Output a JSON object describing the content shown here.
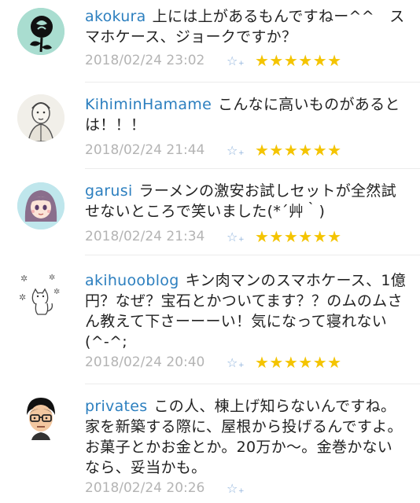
{
  "comments": [
    {
      "user": "akokura",
      "text": "上には上があるもんですねー^^　スマホケース、ジョークですか？",
      "time": "2018/02/24 23:02",
      "add_star": "☆",
      "add_star_plus": "+",
      "stars": "★★★★★★",
      "avatar_icon": "rose-icon"
    },
    {
      "user": "KihiminHamame",
      "text": "こんなに高いものがあるとは！！！",
      "time": "2018/02/24 21:44",
      "add_star": "☆",
      "add_star_plus": "+",
      "stars": "★★★★★★",
      "avatar_icon": "portrait-sketch-icon"
    },
    {
      "user": "garusi",
      "text": "ラーメンの激安お試しセットが全然試せないところで笑いました(*´艸｀)",
      "time": "2018/02/24 21:34",
      "add_star": "☆",
      "add_star_plus": "+",
      "stars": "★★★★★★",
      "avatar_icon": "anime-girl-icon"
    },
    {
      "user": "akihuooblog",
      "text": "キン肉マンのスマホケース、1億円？なぜ？宝石とかついてます？？のムのムさん教えて下さーーーい！気になって寝れない(^-^;",
      "time": "2018/02/24 20:40",
      "add_star": "☆",
      "add_star_plus": "+",
      "stars": "★★★★★★",
      "avatar_icon": "cat-doodle-icon"
    },
    {
      "user": "privates",
      "text": "この人、棟上げ知らないんですね。家を新築する際に、屋根から投げるんですよ。お菓子とかお金とか。20万か〜。金巻かないなら、妥当かも。",
      "time": "2018/02/24 20:26",
      "add_star": "☆",
      "add_star_plus": "+",
      "stars": "",
      "avatar_icon": "glasses-man-icon"
    }
  ],
  "colors": {
    "username": "#2c7fbf",
    "star": "#f4c400",
    "add_star": "#8fb3dc",
    "timestamp": "#b4b4b4"
  }
}
